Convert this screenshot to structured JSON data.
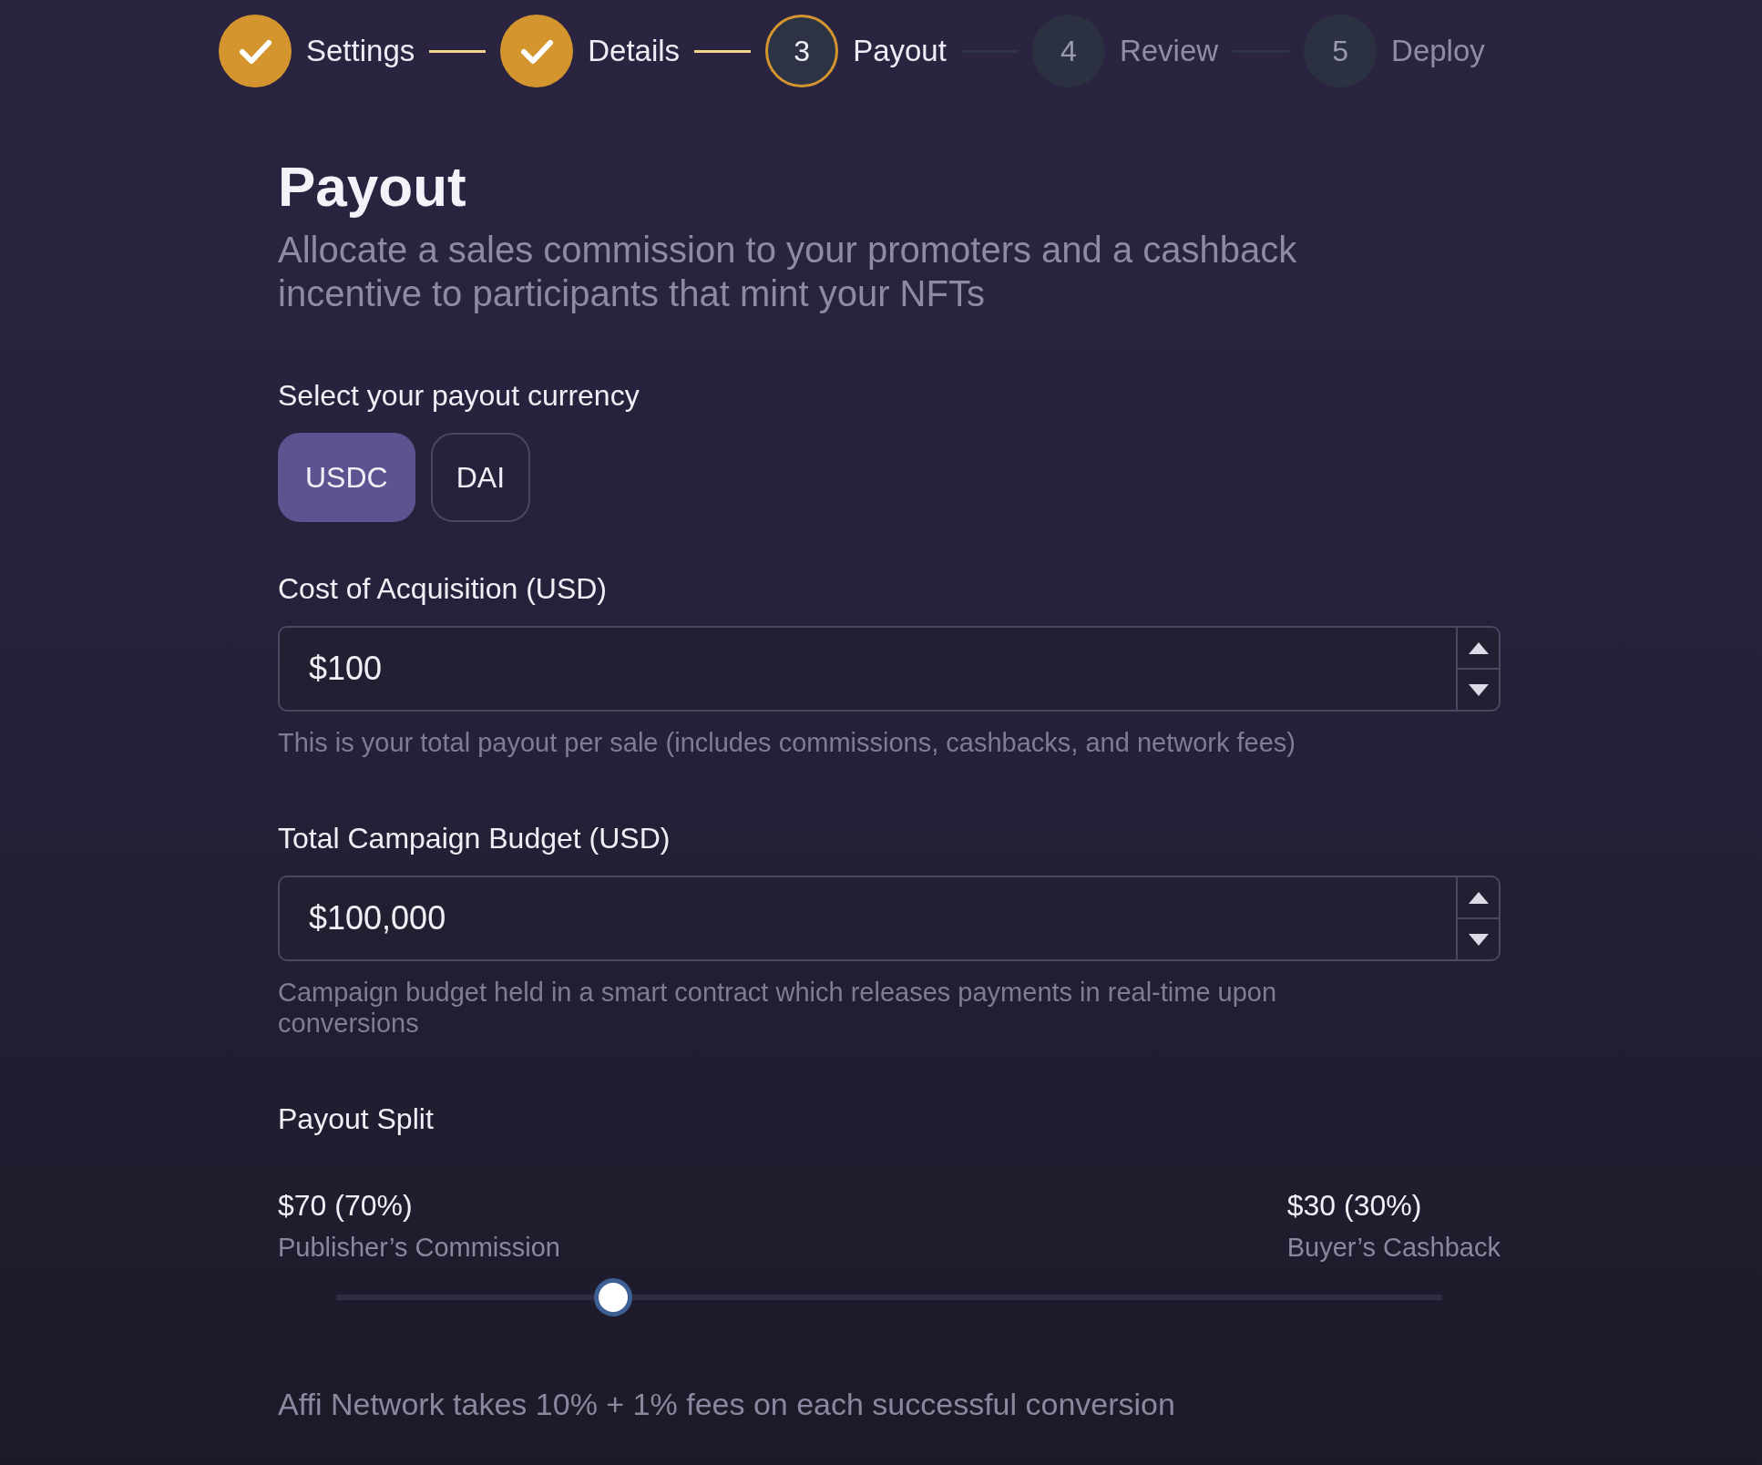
{
  "steps": [
    {
      "label": "Settings",
      "completed": true,
      "selected": false
    },
    {
      "label": "Details",
      "completed": true,
      "selected": false
    },
    {
      "label": "Payout",
      "number": "3",
      "completed": false,
      "selected": true
    },
    {
      "label": "Review",
      "number": "4",
      "completed": false,
      "selected": false
    },
    {
      "label": "Deploy",
      "number": "5",
      "completed": false,
      "selected": false
    }
  ],
  "title": "Payout",
  "subtitle": "Allocate a sales commission to your promoters and a cashback incentive to participants that mint your NFTs",
  "currency": {
    "label": "Select your payout currency",
    "options": [
      {
        "label": "USDC",
        "selected": true
      },
      {
        "label": "DAI",
        "selected": false
      }
    ]
  },
  "fields": [
    {
      "label": "Cost of Acquisition (USD)",
      "value": "$100",
      "help": "This is your total payout per sale (includes commissions, cashbacks, and network fees)"
    },
    {
      "label": "Total Campaign Budget (USD)",
      "value": "$100,000",
      "help": "Campaign budget held in a smart contract which releases payments in real-time upon conversions"
    }
  ],
  "split": {
    "title": "Payout Split",
    "left": {
      "amount": "$70 (70%)",
      "caption": "Publisher’s Commission"
    },
    "right": {
      "amount": "$30 (30%)",
      "caption": "Buyer’s Cashback"
    },
    "level": 0.25
  },
  "note": "Affi Network takes 10% + 1% fees on each successful conversion"
}
